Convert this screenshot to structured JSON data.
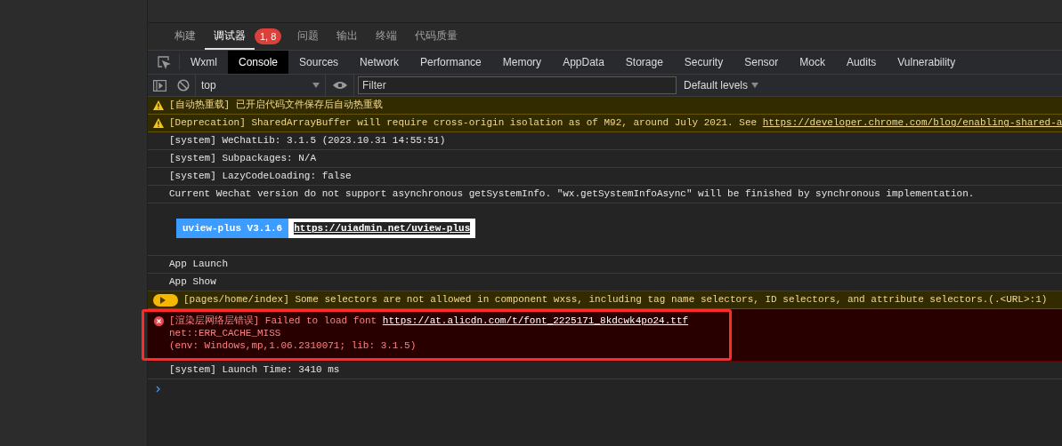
{
  "panel_tabs": [
    {
      "label": "构建",
      "selected": false
    },
    {
      "label": "调试器",
      "selected": true,
      "badge": "1, 8"
    },
    {
      "label": "问题",
      "selected": false
    },
    {
      "label": "输出",
      "selected": false
    },
    {
      "label": "终端",
      "selected": false
    },
    {
      "label": "代码质量",
      "selected": false
    }
  ],
  "devtools_tabs": [
    {
      "label": "Wxml",
      "selected": false
    },
    {
      "label": "Console",
      "selected": true
    },
    {
      "label": "Sources",
      "selected": false
    },
    {
      "label": "Network",
      "selected": false
    },
    {
      "label": "Performance",
      "selected": false
    },
    {
      "label": "Memory",
      "selected": false
    },
    {
      "label": "AppData",
      "selected": false
    },
    {
      "label": "Storage",
      "selected": false
    },
    {
      "label": "Security",
      "selected": false
    },
    {
      "label": "Sensor",
      "selected": false
    },
    {
      "label": "Mock",
      "selected": false
    },
    {
      "label": "Audits",
      "selected": false
    },
    {
      "label": "Vulnerability",
      "selected": false
    }
  ],
  "toolbar": {
    "context": "top",
    "filter_placeholder": "Filter",
    "levels": "Default levels"
  },
  "messages": [
    {
      "kind": "warning",
      "text": "[自动热重载] 已开启代码文件保存后自动热重载"
    },
    {
      "kind": "warning",
      "text": "[Deprecation] SharedArrayBuffer will require cross-origin isolation as of M92, around July 2021. See ",
      "link": "https://developer.chrome.com/blog/enabling-shared-a"
    },
    {
      "kind": "log",
      "text": "[system] WeChatLib: 3.1.5 (2023.10.31 14:55:51)"
    },
    {
      "kind": "log",
      "text": "[system] Subpackages: N/A"
    },
    {
      "kind": "log",
      "text": "[system] LazyCodeLoading: false"
    },
    {
      "kind": "log",
      "text": "Current Wechat version do not support asynchronous getSystemInfo. \"wx.getSystemInfoAsync\" will be finished by synchronous implementation."
    },
    {
      "kind": "banner",
      "badge": "uview-plus V3.1.6",
      "link": "https://uiadmin.net/uview-plus"
    },
    {
      "kind": "log",
      "text": "App Launch"
    },
    {
      "kind": "log",
      "text": "App Show"
    },
    {
      "kind": "warning_group",
      "text": "[pages/home/index] Some selectors are not allowed in component wxss, including tag name selectors, ID selectors, and attribute selectors.(.<URL>:1)"
    },
    {
      "kind": "error",
      "text": "[渲染层网络层错误] Failed to load font ",
      "link": "https://at.alicdn.com/t/font_2225171_8kdcwk4po24.ttf",
      "lines": [
        "net::ERR_CACHE_MISS",
        "(env: Windows,mp,1.06.2310071; lib: 3.1.5)"
      ],
      "highlighted": true
    },
    {
      "kind": "log",
      "text": "[system] Launch Time: 3410 ms"
    }
  ]
}
